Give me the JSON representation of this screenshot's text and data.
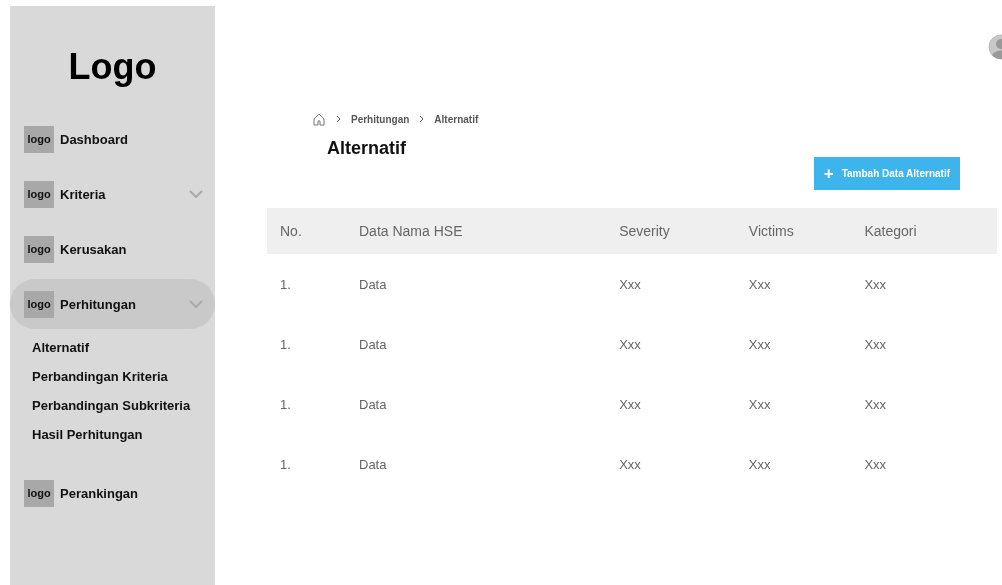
{
  "sidebar": {
    "logo": "Logo",
    "items": [
      {
        "kind": "link",
        "icon_label": "logo",
        "label": "Dashboard",
        "selected": false
      },
      {
        "kind": "group",
        "icon_label": "logo",
        "label": "Kriteria",
        "selected": false
      },
      {
        "kind": "link",
        "icon_label": "logo",
        "label": "Kerusakan",
        "selected": false
      },
      {
        "kind": "group",
        "icon_label": "logo",
        "label": "Perhitungan",
        "selected": true,
        "children": [
          {
            "label": "Alternatif"
          },
          {
            "label": "Perbandingan Kriteria"
          },
          {
            "label": "Perbandingan Subkriteria"
          },
          {
            "label": "Hasil Perhitungan"
          }
        ]
      },
      {
        "kind": "link",
        "icon_label": "logo",
        "label": "Perankingan",
        "selected": false
      }
    ]
  },
  "breadcrumb": [
    "Perhitungan",
    "Alternatif"
  ],
  "page_title": "Alternatif",
  "add_button": {
    "icon": "+",
    "label": "Tambah Data Alternatif"
  },
  "table": {
    "columns": [
      "No.",
      "Data Nama HSE",
      "Severity",
      "Victims",
      "Kategori"
    ],
    "rows": [
      [
        "1.",
        "Data",
        "Xxx",
        "Xxx",
        "Xxx"
      ],
      [
        "1.",
        "Data",
        "Xxx",
        "Xxx",
        "Xxx"
      ],
      [
        "1.",
        "Data",
        "Xxx",
        "Xxx",
        "Xxx"
      ],
      [
        "1.",
        "Data",
        "Xxx",
        "Xxx",
        "Xxx"
      ]
    ]
  }
}
